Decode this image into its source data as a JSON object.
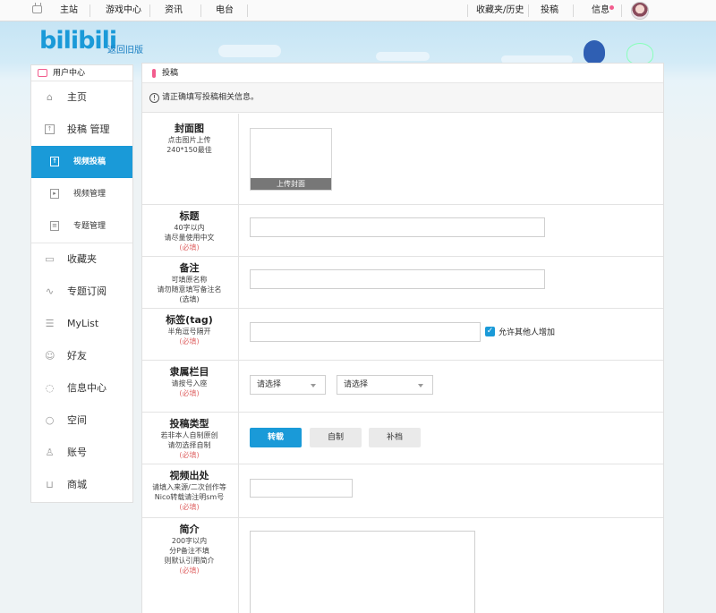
{
  "topbar": {
    "nav": [
      "主站",
      "游戏中心",
      "资讯",
      "电台"
    ],
    "right": [
      "收藏夹/历史",
      "投稿",
      "信息"
    ]
  },
  "banner": {
    "logo": "bilibili",
    "back_old": "返回旧版"
  },
  "sidebar": {
    "header": "用户中心",
    "items": [
      {
        "label": "主页",
        "icon": "home-icon"
      },
      {
        "label": "投稿 管理",
        "icon": "upload-icon"
      }
    ],
    "sub_items": [
      {
        "label": "视频投稿",
        "active": true
      },
      {
        "label": "视频管理",
        "active": false
      },
      {
        "label": "专题管理",
        "active": false
      }
    ],
    "items2": [
      {
        "label": "收藏夹",
        "icon": "folder-icon"
      },
      {
        "label": "专题订阅",
        "icon": "chart-icon"
      },
      {
        "label": "MyList",
        "icon": "list-icon"
      },
      {
        "label": "好友",
        "icon": "friends-icon"
      },
      {
        "label": "信息中心",
        "icon": "message-icon"
      },
      {
        "label": "空间",
        "icon": "space-icon"
      },
      {
        "label": "账号",
        "icon": "account-icon"
      },
      {
        "label": "商城",
        "icon": "cart-icon"
      }
    ]
  },
  "panel": {
    "title": "投稿",
    "notice": "请正确填写投稿相关信息。",
    "cover": {
      "title": "封面图",
      "desc1": "点击图片上传",
      "desc2": "240*150最佳",
      "button": "上传封面"
    },
    "title_field": {
      "title": "标题",
      "desc1": "40字以内",
      "desc2": "请尽量使用中文",
      "req": "(必填)"
    },
    "note_field": {
      "title": "备注",
      "desc1": "可填原名称",
      "desc2": "请勿随意填写备注名",
      "req": "(选填)"
    },
    "tag_field": {
      "title": "标签(tag)",
      "desc1": "半角逗号隔开",
      "req": "(必填)",
      "allow_label": "允许其他人增加",
      "allow_checked": true
    },
    "category_field": {
      "title": "隶属栏目",
      "desc1": "请按号入座",
      "req": "(必填)",
      "select1": "请选择",
      "select2": "请选择"
    },
    "type_field": {
      "title": "投稿类型",
      "desc1": "若非本人自制原创",
      "desc2": "请勿选择自制",
      "req": "(必填)",
      "options": [
        "转载",
        "自制",
        "补档"
      ],
      "selected": "转载"
    },
    "source_field": {
      "title": "视频出处",
      "desc1": "请填入来源/二次创作等",
      "desc2": "Nico转载请注明sm号",
      "req": "(必填)"
    },
    "intro_field": {
      "title": "简介",
      "desc1": "200字以内",
      "desc2": "分P备注不填",
      "desc3": "则默认引用简介",
      "req": "(必填)"
    }
  },
  "colors": {
    "accent": "#1a9ad8",
    "pink": "#f25d8e",
    "required": "#e06a6a"
  }
}
